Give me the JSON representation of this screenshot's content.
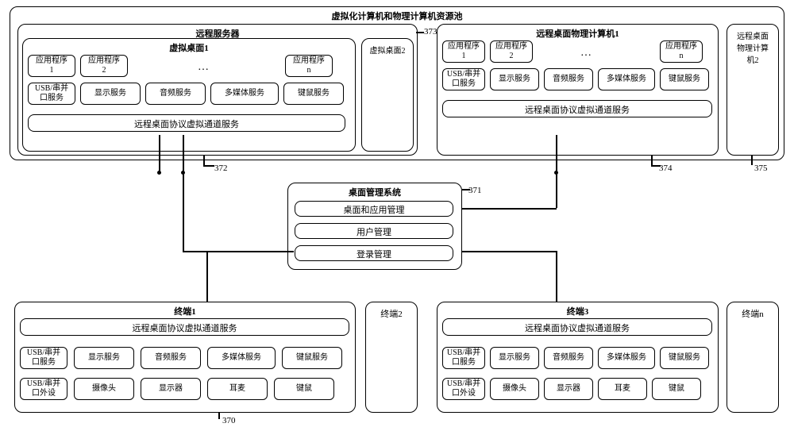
{
  "pool": {
    "title": "虚拟化计算机和物理计算机资源池",
    "label_372": "372",
    "label_373": "373",
    "label_374": "374",
    "label_375": "375",
    "label_371": "371",
    "label_370": "370"
  },
  "remote_server": {
    "title": "远程服务器",
    "vd1_title": "虚拟桌面1",
    "vd2_title": "虚拟桌面2",
    "app1": "应用程序\n1",
    "app2": "应用程序\n2",
    "appn": "应用程序\nn",
    "ellipsis": "…",
    "svc_usb": "USB/串并\n口服务",
    "svc_display": "显示服务",
    "svc_audio": "音频服务",
    "svc_media": "多媒体服务",
    "svc_km": "键鼠服务",
    "channel": "远程桌面协议虚拟通道服务"
  },
  "physical1": {
    "title": "远程桌面物理计算机1",
    "app1": "应用程序\n1",
    "app2": "应用程序\n2",
    "appn": "应用程序\nn",
    "ellipsis": "…",
    "svc_usb": "USB/串并\n口服务",
    "svc_display": "显示服务",
    "svc_audio": "音频服务",
    "svc_media": "多媒体服务",
    "svc_km": "键鼠服务",
    "channel": "远程桌面协议虚拟通道服务"
  },
  "physical2": {
    "title": "远程桌面\n物理计算\n机2"
  },
  "dms": {
    "title": "桌面管理系统",
    "item1": "桌面和应用管理",
    "item2": "用户管理",
    "item3": "登录管理"
  },
  "terminal1": {
    "title": "终端1",
    "channel": "远程桌面协议虚拟通道服务",
    "svc_usb": "USB/串并\n口服务",
    "svc_display": "显示服务",
    "svc_audio": "音频服务",
    "svc_media": "多媒体服务",
    "svc_km": "键鼠服务",
    "hw_usb": "USB/串并\n口外设",
    "hw_cam": "摄像头",
    "hw_disp": "显示器",
    "hw_ear": "耳麦",
    "hw_km": "键鼠"
  },
  "terminal2": {
    "title": "终端2"
  },
  "terminal3": {
    "title": "终端3",
    "channel": "远程桌面协议虚拟通道服务",
    "svc_usb": "USB/串并\n口服务",
    "svc_display": "显示服务",
    "svc_audio": "音频服务",
    "svc_media": "多媒体服务",
    "svc_km": "键鼠服务",
    "hw_usb": "USB/串并\n口外设",
    "hw_cam": "摄像头",
    "hw_disp": "显示器",
    "hw_ear": "耳麦",
    "hw_km": "键鼠"
  },
  "terminaln": {
    "title": "终端n"
  }
}
